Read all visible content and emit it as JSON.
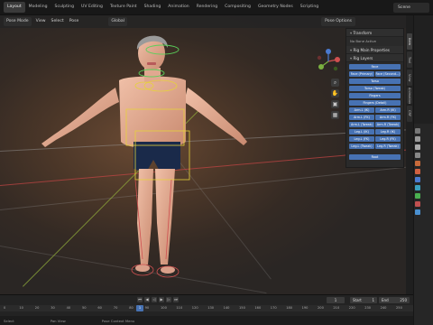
{
  "topbar": {
    "tabs": [
      "Layout",
      "Modeling",
      "Sculpting",
      "UV Editing",
      "Texture Paint",
      "Shading",
      "Animation",
      "Rendering",
      "Compositing",
      "Geometry Nodes",
      "Scripting"
    ],
    "active_tab": "Layout",
    "scene": "Scene"
  },
  "viewport": {
    "mode": "Pose Mode",
    "menus": [
      "View",
      "Select",
      "Pose"
    ],
    "transform_orientation": "Global",
    "pose_options": "Pose Options"
  },
  "npanel": {
    "transform": "Transform",
    "no_bone_active": "No Bone Active",
    "rig_main_properties": "Rig Main Properties",
    "rig_layers": "Rig Layers",
    "layers": [
      [
        "Face"
      ],
      [
        "Face (Primary)",
        "Face (Second...)"
      ],
      [
        "Torso"
      ],
      [
        "Torso (Tweak)"
      ],
      [
        "Fingers"
      ],
      [
        "Fingers (Detail)"
      ],
      [
        "Arm.L (IK)",
        "Arm.R (IK)"
      ],
      [
        "Arm.L (FK)",
        "Arm.R (FK)"
      ],
      [
        "Arm.L (Tweak)",
        "Arm.R (Tweak)"
      ],
      [
        "Leg.L (IK)",
        "Leg.R (IK)"
      ],
      [
        "Leg.L (FK)",
        "Leg.R (FK)"
      ],
      [
        "Leg.L (Tweak)",
        "Leg.R (Tweak)"
      ],
      [
        "Root"
      ]
    ],
    "side_tabs": [
      "Item",
      "Tool",
      "View",
      "Animation",
      "CRF"
    ]
  },
  "timeline": {
    "current_frame": "1",
    "start_label": "Start",
    "start": "1",
    "end_label": "End",
    "end": "250",
    "ticks": [
      "0",
      "10",
      "20",
      "30",
      "40",
      "50",
      "60",
      "70",
      "80",
      "90",
      "100",
      "110",
      "120",
      "130",
      "140",
      "150",
      "160",
      "170",
      "180",
      "190",
      "200",
      "210",
      "220",
      "230",
      "240",
      "250"
    ]
  },
  "status": {
    "left": "Select",
    "middle": "Pan View",
    "right": "Pose Context Menu"
  }
}
